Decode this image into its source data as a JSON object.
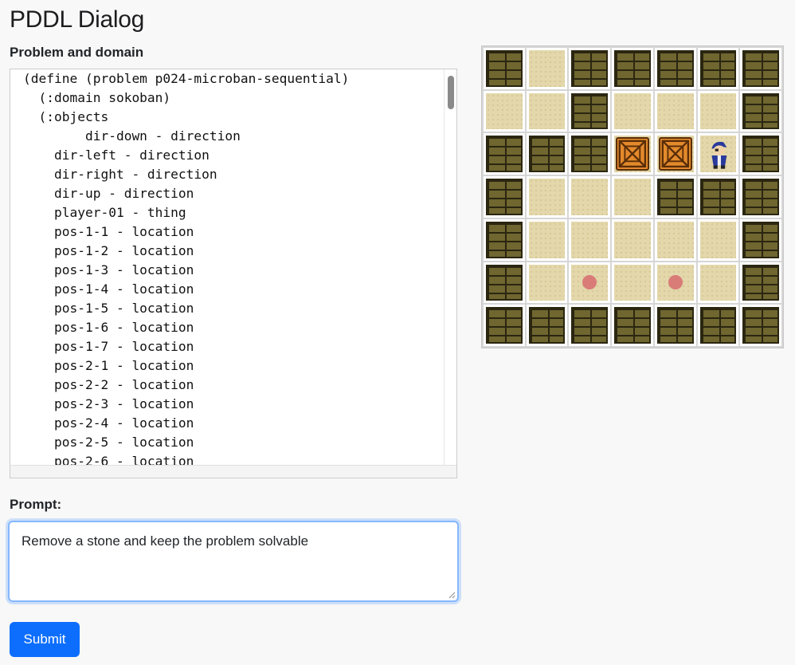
{
  "page": {
    "title": "PDDL Dialog"
  },
  "problem_domain": {
    "label": "Problem and domain",
    "lines": [
      "(define (problem p024-microban-sequential)",
      "  (:domain sokoban)",
      "  (:objects",
      "        dir-down - direction",
      "    dir-left - direction",
      "    dir-right - direction",
      "    dir-up - direction",
      "    player-01 - thing",
      "    pos-1-1 - location",
      "    pos-1-2 - location",
      "    pos-1-3 - location",
      "    pos-1-4 - location",
      "    pos-1-5 - location",
      "    pos-1-6 - location",
      "    pos-1-7 - location",
      "    pos-2-1 - location",
      "    pos-2-2 - location",
      "    pos-2-3 - location",
      "    pos-2-4 - location",
      "    pos-2-5 - location",
      "    pos-2-6 - location"
    ]
  },
  "board": {
    "rows": [
      [
        "wall",
        "floor",
        "wall",
        "wall",
        "wall",
        "wall",
        "wall"
      ],
      [
        "floor",
        "floor",
        "wall",
        "floor",
        "floor",
        "floor",
        "wall"
      ],
      [
        "wall",
        "wall",
        "wall",
        "crate",
        "crate",
        "player",
        "wall"
      ],
      [
        "wall",
        "floor",
        "floor",
        "floor",
        "wall",
        "wall",
        "wall"
      ],
      [
        "wall",
        "floor",
        "floor",
        "floor",
        "floor",
        "floor",
        "wall"
      ],
      [
        "wall",
        "floor",
        "goal",
        "floor",
        "goal",
        "floor",
        "wall"
      ],
      [
        "wall",
        "wall",
        "wall",
        "wall",
        "wall",
        "wall",
        "wall"
      ]
    ],
    "colors": {
      "wall": "#6f6630",
      "floor": "#e3d7ab",
      "goal": "#d97b77",
      "crate": "#e48a2c",
      "player": "#2a3a9c"
    }
  },
  "prompt": {
    "label": "Prompt:",
    "value": "Remove a stone and keep the problem solvable"
  },
  "submit": {
    "label": "Submit"
  }
}
